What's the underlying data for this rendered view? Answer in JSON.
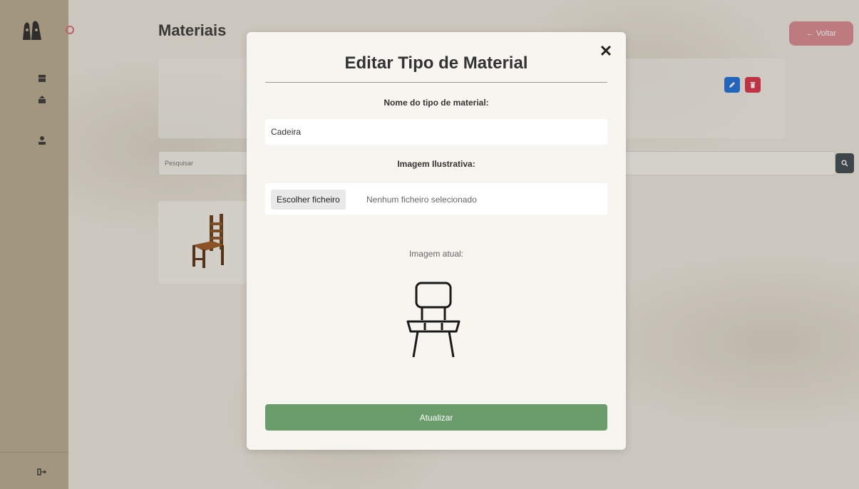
{
  "page": {
    "title": "Materiais",
    "back_label": "← Voltar",
    "search_placeholder": "Pesquisar"
  },
  "icons": {
    "logo": "logo-icon",
    "sidebar": [
      "list-icon",
      "archive-icon",
      "user-icon"
    ],
    "logout": "logout-icon",
    "edit": "pencil-icon",
    "delete": "trash-icon",
    "search": "search-icon",
    "close": "close-icon"
  },
  "colors": {
    "sidebar": "#b9ab92",
    "back_button": "#d98a93",
    "edit_button": "#1e6fd9",
    "delete_button": "#d9324a",
    "search_button": "#3d4a52",
    "submit_button": "#6b9c6b"
  },
  "modal": {
    "title": "Editar Tipo de Material",
    "close_symbol": "✕",
    "name_label": "Nome do tipo de material:",
    "name_value": "Cadeira",
    "image_label": "Imagem Ilustrativa:",
    "file_button_label": "Escolher ficheiro",
    "file_status": "Nenhum ficheiro selecionado",
    "current_image_label": "Imagem atual:",
    "submit_label": "Atualizar"
  }
}
